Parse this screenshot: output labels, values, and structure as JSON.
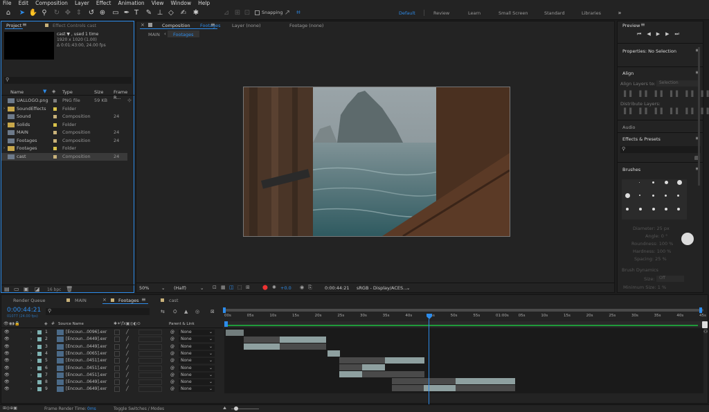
{
  "menu": [
    "File",
    "Edit",
    "Composition",
    "Layer",
    "Effect",
    "Animation",
    "View",
    "Window",
    "Help"
  ],
  "toolbar": {
    "snapping": "Snapping"
  },
  "workspaces": [
    "Default",
    "Review",
    "Learn",
    "Small Screen",
    "Standard",
    "Libraries"
  ],
  "project": {
    "tab": "Project",
    "effect_tab": "Effect Controls cast",
    "item_name": "cast ▼ , used 1 time",
    "item_res": "1920 x 1020 (1.00)",
    "item_dur": "Δ 0:01:43:00, 24.00 fps",
    "columns": {
      "name": "Name",
      "type": "Type",
      "size": "Size",
      "frame": "Frame R..."
    },
    "items": [
      {
        "name": "UALLOGO.png",
        "type": "PNG file",
        "size": "59 KB",
        "frame": "",
        "color": "#7d7d7d"
      },
      {
        "name": "SoundEffects",
        "type": "Folder",
        "size": "",
        "frame": "",
        "color": "#d8c24a"
      },
      {
        "name": "Sound",
        "type": "Composition",
        "size": "",
        "frame": "24",
        "color": "#c9b27a"
      },
      {
        "name": "Solids",
        "type": "Folder",
        "size": "",
        "frame": "",
        "color": "#d8c24a"
      },
      {
        "name": "MAIN",
        "type": "Composition",
        "size": "",
        "frame": "24",
        "color": "#c9b27a"
      },
      {
        "name": "Footages",
        "type": "Composition",
        "size": "",
        "frame": "24",
        "color": "#c9b27a"
      },
      {
        "name": "Footages",
        "type": "Folder",
        "size": "",
        "frame": "",
        "color": "#d8c24a"
      },
      {
        "name": "cast",
        "type": "Composition",
        "size": "",
        "frame": "24",
        "color": "#c9b27a"
      }
    ],
    "bpc": "16 bpc"
  },
  "comp": {
    "tab_comp": "Composition",
    "tab_comp_name": "Footages",
    "tab_layer": "Layer (none)",
    "tab_footage": "Footage (none)",
    "crumb_main": "MAIN",
    "crumb_footages": "Footages",
    "zoom": "50%",
    "res": "(Half)",
    "exposure": "+0.0",
    "time": "0:00:44:21",
    "colorspace": "sRGB - Display/ACES..."
  },
  "right": {
    "preview": "Preview",
    "properties": "Properties: No Selection",
    "align": "Align",
    "align_to": "Align Layers to:",
    "align_sel": "Selection",
    "distribute": "Distribute Layers:",
    "audio": "Audio",
    "effects": "Effects & Presets",
    "brushes": "Brushes",
    "brush_sizes": [
      "1",
      "3",
      "5",
      "9",
      "13",
      "19",
      "5",
      "9",
      "13",
      "17",
      "21",
      "27",
      "35",
      "45",
      "65"
    ],
    "diameter": "Diameter: 25 px",
    "angle": "Angle: 0 °",
    "roundness": "Roundness: 100 %",
    "hardness": "Hardness: 100 %",
    "spacing": "Spacing: 25 %",
    "dynamics": "Brush Dynamics",
    "size_label": "Size:",
    "size_val": "Off",
    "min_size": "Minimum Size: 1 %"
  },
  "timeline": {
    "tabs": [
      "Render Queue",
      "MAIN",
      "Footages",
      "cast"
    ],
    "timecode": "0:00:44:21",
    "frames": "01077 (24.00 fps)",
    "col_source": "Source Name",
    "col_parent": "Parent & Link",
    "ruler": [
      "00s",
      "05s",
      "10s",
      "15s",
      "20s",
      "25s",
      "30s",
      "35s",
      "40s",
      "45s",
      "50s",
      "55s",
      "01:00s",
      "05s",
      "10s",
      "15s",
      "20s",
      "25s",
      "30s",
      "35s",
      "40s",
      "45s"
    ],
    "layers": [
      {
        "num": "1",
        "name": "[Encoun...0096].exr",
        "parent": "None"
      },
      {
        "num": "2",
        "name": "[Encoun...0449].exr",
        "parent": "None"
      },
      {
        "num": "3",
        "name": "[Encoun...0449].exr",
        "parent": "None"
      },
      {
        "num": "4",
        "name": "[Encoun...0065].exr",
        "parent": "None"
      },
      {
        "num": "5",
        "name": "[Encoun...0451].exr",
        "parent": "None"
      },
      {
        "num": "6",
        "name": "[Encoun...0451].exr",
        "parent": "None"
      },
      {
        "num": "7",
        "name": "[Encoun...0451].exr",
        "parent": "None"
      },
      {
        "num": "8",
        "name": "[Encoun...0649].exr",
        "parent": "None"
      },
      {
        "num": "9",
        "name": "[Encoun...0649].exr",
        "parent": "None"
      }
    ],
    "status_render": "Frame Render Time:",
    "status_render_val": "0ms",
    "status_toggle": "Toggle Switches / Modes"
  },
  "colors": {
    "accent": "#2d8ceb",
    "layer_label": "#7fb3b3"
  }
}
